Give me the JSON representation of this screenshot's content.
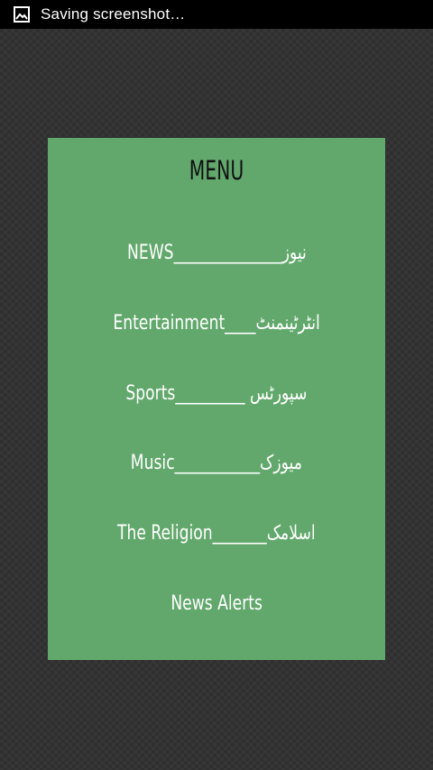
{
  "status_bar": {
    "icon": "image-icon",
    "text": "Saving screenshot…"
  },
  "menu": {
    "title": "MENU",
    "items": [
      {
        "english": "NEWS",
        "separator": "______________",
        "urdu": "نیوز"
      },
      {
        "english": "Entertainment",
        "separator": "____",
        "urdu": "انٹرٹینمنٹ"
      },
      {
        "english": "Sports",
        "separator": "_________ ",
        "urdu": "سپورٹس"
      },
      {
        "english": "Music",
        "separator": "___________",
        "urdu": "میوزک"
      },
      {
        "english": "The Religion",
        "separator": "_______",
        "urdu": "اسلامک"
      },
      {
        "english": "News Alerts",
        "separator": "",
        "urdu": ""
      }
    ]
  },
  "colors": {
    "panel_background": "#62a86c",
    "page_background": "#2e2f2e",
    "status_bar": "#000000"
  }
}
